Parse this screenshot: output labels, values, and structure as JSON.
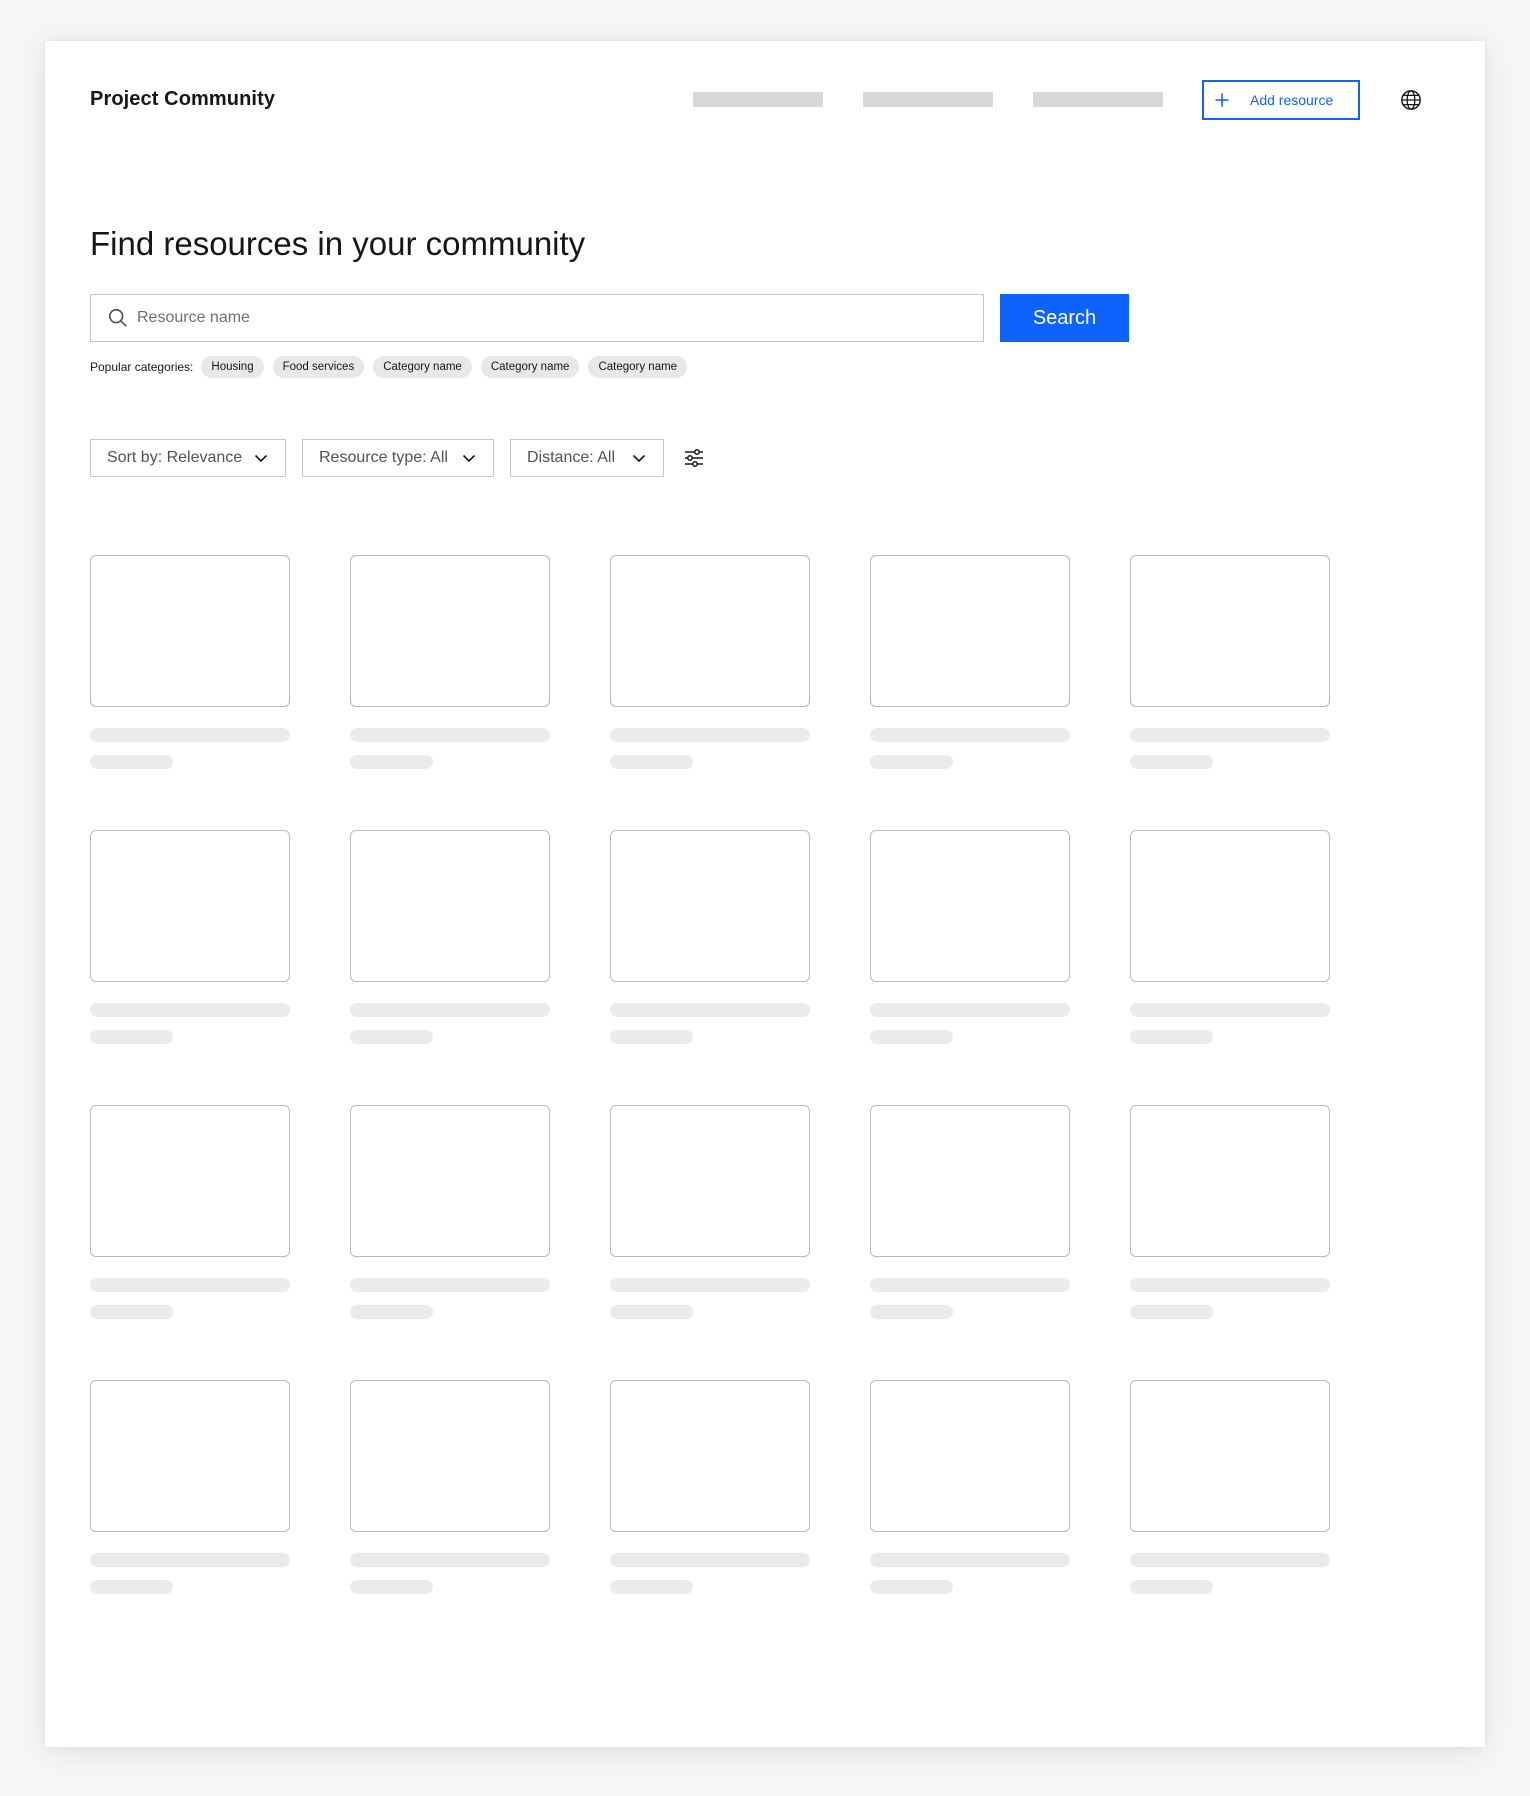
{
  "header": {
    "logo": "Project Community",
    "nav_placeholders": 3,
    "add_button_label": "Add resource"
  },
  "hero": {
    "title": "Find resources in your community"
  },
  "search": {
    "placeholder": "Resource name",
    "value": "",
    "button_label": "Search"
  },
  "popular": {
    "label": "Popular categories:",
    "chips": [
      "Housing",
      "Food services",
      "Category name",
      "Category name",
      "Category name"
    ]
  },
  "filters": {
    "sort_label": "Sort by: Relevance",
    "type_label": "Resource type: All",
    "distance_label": "Distance: All"
  },
  "results": {
    "rows": 4,
    "columns": 5,
    "loading": true
  },
  "colors": {
    "accent": "#0f62fe",
    "skeleton": "#ebebeb",
    "nav_skeleton": "#d8d8d8"
  },
  "icons": [
    "plus-icon",
    "globe-icon",
    "search-icon",
    "chevron-down-icon",
    "filter-settings-icon"
  ]
}
